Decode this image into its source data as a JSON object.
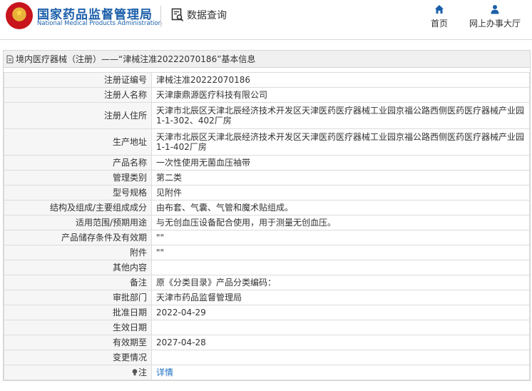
{
  "header": {
    "site_title_cn": "国家药品监督管理局",
    "site_title_en": "National Medical Products Administration",
    "query_label": "数据查询",
    "nav": [
      {
        "label": "首页",
        "icon": "home-icon"
      },
      {
        "label": "网上办事大厅",
        "icon": "user-icon"
      }
    ]
  },
  "panel": {
    "title": "境内医疗器械（注册）——“津械注准20222070186”基本信息"
  },
  "rows": [
    {
      "label": "注册证编号",
      "value": "津械注准20222070186"
    },
    {
      "label": "注册人名称",
      "value": "天津康鼎源医疗科技有限公司"
    },
    {
      "label": "注册人住所",
      "value": "天津市北辰区天津北辰经济技术开发区天津医药医疗器械工业园京福公路西侧医药医疗器械产业园1-1-302、402厂房"
    },
    {
      "label": "生产地址",
      "value": "天津市北辰区天津北辰经济技术开发区天津医药医疗器械工业园京福公路西侧医药医疗器械产业园1-1-402厂房"
    },
    {
      "label": "产品名称",
      "value": "一次性使用无菌血压袖带"
    },
    {
      "label": "管理类别",
      "value": "第二类"
    },
    {
      "label": "型号规格",
      "value": "见附件"
    },
    {
      "label": "结构及组成/主要组成成分",
      "value": "由布套、气囊、气管和魔术贴组成。"
    },
    {
      "label": "适用范围/预期用途",
      "value": "与无创血压设备配合使用，用于测量无创血压。"
    },
    {
      "label": "产品储存条件及有效期",
      "value": "\"\""
    },
    {
      "label": "附件",
      "value": "\"\""
    },
    {
      "label": "其他内容",
      "value": ""
    },
    {
      "label": "备注",
      "value": "原《分类目录》产品分类编码："
    },
    {
      "label": "审批部门",
      "value": "天津市药品监督管理局"
    },
    {
      "label": "批准日期",
      "value": "2022-04-29"
    },
    {
      "label": "生效日期",
      "value": ""
    },
    {
      "label": "有效期至",
      "value": "2027-04-28"
    },
    {
      "label": "变更情况",
      "value": ""
    }
  ],
  "note_row": {
    "label": "注",
    "link_text": "详情"
  },
  "colors": {
    "brand_blue": "#1b5faa",
    "link_blue": "#1b6ec2",
    "emblem_red": "#c8141c"
  }
}
